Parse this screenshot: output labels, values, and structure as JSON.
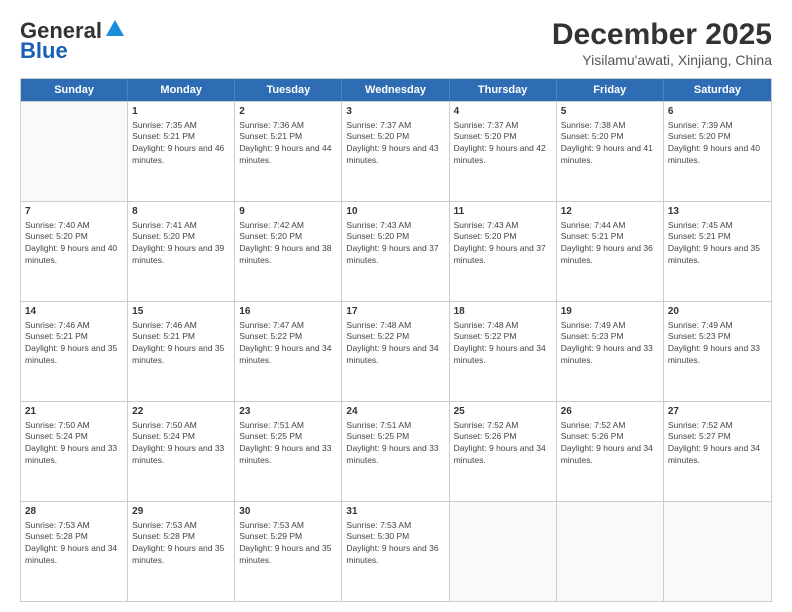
{
  "logo": {
    "general": "General",
    "blue": "Blue"
  },
  "header": {
    "month": "December 2025",
    "location": "Yisilamu'awati, Xinjiang, China"
  },
  "weekdays": [
    "Sunday",
    "Monday",
    "Tuesday",
    "Wednesday",
    "Thursday",
    "Friday",
    "Saturday"
  ],
  "weeks": [
    [
      {
        "day": "",
        "sunrise": "",
        "sunset": "",
        "daylight": ""
      },
      {
        "day": "1",
        "sunrise": "Sunrise: 7:35 AM",
        "sunset": "Sunset: 5:21 PM",
        "daylight": "Daylight: 9 hours and 46 minutes."
      },
      {
        "day": "2",
        "sunrise": "Sunrise: 7:36 AM",
        "sunset": "Sunset: 5:21 PM",
        "daylight": "Daylight: 9 hours and 44 minutes."
      },
      {
        "day": "3",
        "sunrise": "Sunrise: 7:37 AM",
        "sunset": "Sunset: 5:20 PM",
        "daylight": "Daylight: 9 hours and 43 minutes."
      },
      {
        "day": "4",
        "sunrise": "Sunrise: 7:37 AM",
        "sunset": "Sunset: 5:20 PM",
        "daylight": "Daylight: 9 hours and 42 minutes."
      },
      {
        "day": "5",
        "sunrise": "Sunrise: 7:38 AM",
        "sunset": "Sunset: 5:20 PM",
        "daylight": "Daylight: 9 hours and 41 minutes."
      },
      {
        "day": "6",
        "sunrise": "Sunrise: 7:39 AM",
        "sunset": "Sunset: 5:20 PM",
        "daylight": "Daylight: 9 hours and 40 minutes."
      }
    ],
    [
      {
        "day": "7",
        "sunrise": "Sunrise: 7:40 AM",
        "sunset": "Sunset: 5:20 PM",
        "daylight": "Daylight: 9 hours and 40 minutes."
      },
      {
        "day": "8",
        "sunrise": "Sunrise: 7:41 AM",
        "sunset": "Sunset: 5:20 PM",
        "daylight": "Daylight: 9 hours and 39 minutes."
      },
      {
        "day": "9",
        "sunrise": "Sunrise: 7:42 AM",
        "sunset": "Sunset: 5:20 PM",
        "daylight": "Daylight: 9 hours and 38 minutes."
      },
      {
        "day": "10",
        "sunrise": "Sunrise: 7:43 AM",
        "sunset": "Sunset: 5:20 PM",
        "daylight": "Daylight: 9 hours and 37 minutes."
      },
      {
        "day": "11",
        "sunrise": "Sunrise: 7:43 AM",
        "sunset": "Sunset: 5:20 PM",
        "daylight": "Daylight: 9 hours and 37 minutes."
      },
      {
        "day": "12",
        "sunrise": "Sunrise: 7:44 AM",
        "sunset": "Sunset: 5:21 PM",
        "daylight": "Daylight: 9 hours and 36 minutes."
      },
      {
        "day": "13",
        "sunrise": "Sunrise: 7:45 AM",
        "sunset": "Sunset: 5:21 PM",
        "daylight": "Daylight: 9 hours and 35 minutes."
      }
    ],
    [
      {
        "day": "14",
        "sunrise": "Sunrise: 7:46 AM",
        "sunset": "Sunset: 5:21 PM",
        "daylight": "Daylight: 9 hours and 35 minutes."
      },
      {
        "day": "15",
        "sunrise": "Sunrise: 7:46 AM",
        "sunset": "Sunset: 5:21 PM",
        "daylight": "Daylight: 9 hours and 35 minutes."
      },
      {
        "day": "16",
        "sunrise": "Sunrise: 7:47 AM",
        "sunset": "Sunset: 5:22 PM",
        "daylight": "Daylight: 9 hours and 34 minutes."
      },
      {
        "day": "17",
        "sunrise": "Sunrise: 7:48 AM",
        "sunset": "Sunset: 5:22 PM",
        "daylight": "Daylight: 9 hours and 34 minutes."
      },
      {
        "day": "18",
        "sunrise": "Sunrise: 7:48 AM",
        "sunset": "Sunset: 5:22 PM",
        "daylight": "Daylight: 9 hours and 34 minutes."
      },
      {
        "day": "19",
        "sunrise": "Sunrise: 7:49 AM",
        "sunset": "Sunset: 5:23 PM",
        "daylight": "Daylight: 9 hours and 33 minutes."
      },
      {
        "day": "20",
        "sunrise": "Sunrise: 7:49 AM",
        "sunset": "Sunset: 5:23 PM",
        "daylight": "Daylight: 9 hours and 33 minutes."
      }
    ],
    [
      {
        "day": "21",
        "sunrise": "Sunrise: 7:50 AM",
        "sunset": "Sunset: 5:24 PM",
        "daylight": "Daylight: 9 hours and 33 minutes."
      },
      {
        "day": "22",
        "sunrise": "Sunrise: 7:50 AM",
        "sunset": "Sunset: 5:24 PM",
        "daylight": "Daylight: 9 hours and 33 minutes."
      },
      {
        "day": "23",
        "sunrise": "Sunrise: 7:51 AM",
        "sunset": "Sunset: 5:25 PM",
        "daylight": "Daylight: 9 hours and 33 minutes."
      },
      {
        "day": "24",
        "sunrise": "Sunrise: 7:51 AM",
        "sunset": "Sunset: 5:25 PM",
        "daylight": "Daylight: 9 hours and 33 minutes."
      },
      {
        "day": "25",
        "sunrise": "Sunrise: 7:52 AM",
        "sunset": "Sunset: 5:26 PM",
        "daylight": "Daylight: 9 hours and 34 minutes."
      },
      {
        "day": "26",
        "sunrise": "Sunrise: 7:52 AM",
        "sunset": "Sunset: 5:26 PM",
        "daylight": "Daylight: 9 hours and 34 minutes."
      },
      {
        "day": "27",
        "sunrise": "Sunrise: 7:52 AM",
        "sunset": "Sunset: 5:27 PM",
        "daylight": "Daylight: 9 hours and 34 minutes."
      }
    ],
    [
      {
        "day": "28",
        "sunrise": "Sunrise: 7:53 AM",
        "sunset": "Sunset: 5:28 PM",
        "daylight": "Daylight: 9 hours and 34 minutes."
      },
      {
        "day": "29",
        "sunrise": "Sunrise: 7:53 AM",
        "sunset": "Sunset: 5:28 PM",
        "daylight": "Daylight: 9 hours and 35 minutes."
      },
      {
        "day": "30",
        "sunrise": "Sunrise: 7:53 AM",
        "sunset": "Sunset: 5:29 PM",
        "daylight": "Daylight: 9 hours and 35 minutes."
      },
      {
        "day": "31",
        "sunrise": "Sunrise: 7:53 AM",
        "sunset": "Sunset: 5:30 PM",
        "daylight": "Daylight: 9 hours and 36 minutes."
      },
      {
        "day": "",
        "sunrise": "",
        "sunset": "",
        "daylight": ""
      },
      {
        "day": "",
        "sunrise": "",
        "sunset": "",
        "daylight": ""
      },
      {
        "day": "",
        "sunrise": "",
        "sunset": "",
        "daylight": ""
      }
    ]
  ]
}
